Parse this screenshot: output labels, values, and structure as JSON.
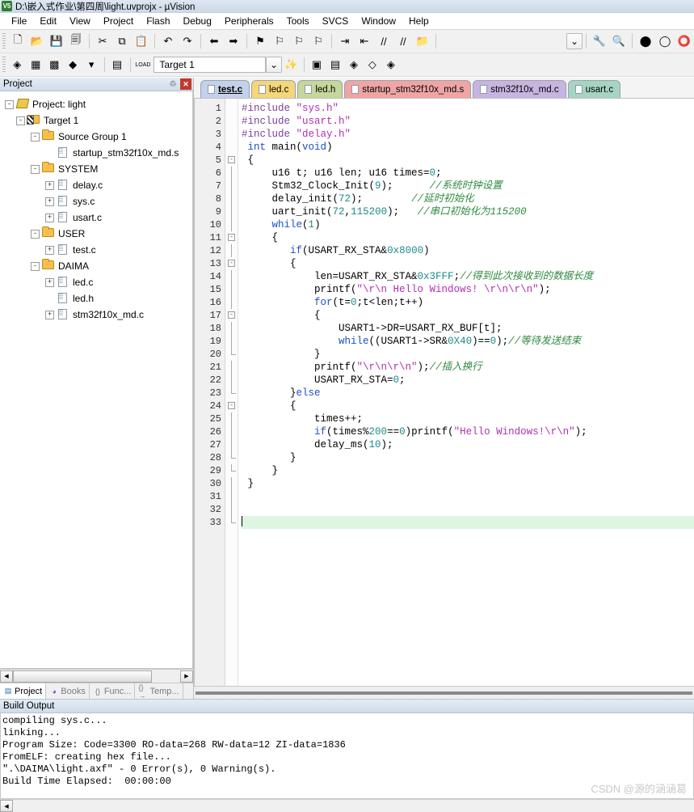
{
  "window": {
    "title": "D:\\嵌入式作业\\第四周\\light.uvprojx - µVision",
    "logo_text": "V5"
  },
  "menubar": {
    "items": [
      {
        "label": "File"
      },
      {
        "label": "Edit"
      },
      {
        "label": "View"
      },
      {
        "label": "Project"
      },
      {
        "label": "Flash"
      },
      {
        "label": "Debug"
      },
      {
        "label": "Peripherals"
      },
      {
        "label": "Tools"
      },
      {
        "label": "SVCS"
      },
      {
        "label": "Window"
      },
      {
        "label": "Help"
      }
    ]
  },
  "toolbar_main": {
    "buttons": [
      {
        "name": "new-file-icon",
        "glyph": "🗋"
      },
      {
        "name": "open-file-icon",
        "glyph": "📂"
      },
      {
        "name": "save-icon",
        "glyph": "💾"
      },
      {
        "name": "save-all-icon",
        "glyph": "🗐"
      },
      {
        "name": "cut-icon",
        "glyph": "✂"
      },
      {
        "name": "copy-icon",
        "glyph": "⧉"
      },
      {
        "name": "paste-icon",
        "glyph": "📋"
      },
      {
        "name": "undo-icon",
        "glyph": "↶"
      },
      {
        "name": "redo-icon",
        "glyph": "↷"
      },
      {
        "name": "navigate-back-icon",
        "glyph": "⬅"
      },
      {
        "name": "navigate-forward-icon",
        "glyph": "➡"
      },
      {
        "name": "toggle-bookmark-icon",
        "glyph": "⚑"
      },
      {
        "name": "prev-bookmark-icon",
        "glyph": "⚐"
      },
      {
        "name": "next-bookmark-icon",
        "glyph": "⚐"
      },
      {
        "name": "clear-bookmarks-icon",
        "glyph": "⚐"
      },
      {
        "name": "indent-icon",
        "glyph": "⇥"
      },
      {
        "name": "outdent-icon",
        "glyph": "⇤"
      },
      {
        "name": "comment-icon",
        "glyph": "//"
      },
      {
        "name": "uncomment-icon",
        "glyph": "//"
      },
      {
        "name": "open-folder-icon",
        "glyph": "📁"
      }
    ],
    "right_buttons": [
      {
        "name": "configure-target-dropdown-icon",
        "glyph": "⌄"
      },
      {
        "name": "options-target-icon",
        "glyph": "🔧"
      },
      {
        "name": "find-in-files-icon",
        "glyph": "🔍"
      },
      {
        "name": "start-debug-icon",
        "glyph": "⬤"
      },
      {
        "name": "insert-breakpoint-icon",
        "glyph": "◯"
      },
      {
        "name": "kill-breakpoints-icon",
        "glyph": "⭕"
      }
    ]
  },
  "toolbar_build": {
    "buttons": [
      {
        "name": "translate-icon",
        "glyph": "◈"
      },
      {
        "name": "build-icon",
        "glyph": "▦"
      },
      {
        "name": "rebuild-icon",
        "glyph": "▩"
      },
      {
        "name": "batch-build-icon",
        "glyph": "◆"
      },
      {
        "name": "batch-build-dropdown-icon",
        "glyph": "▾"
      },
      {
        "name": "stop-build-icon",
        "glyph": "▤"
      },
      {
        "name": "download-icon",
        "glyph": "LOAD"
      }
    ],
    "target_label": "Target 1",
    "right_buttons": [
      {
        "name": "target-options-dropdown-icon",
        "glyph": "⌄"
      },
      {
        "name": "magic-wand-icon",
        "glyph": "✨"
      },
      {
        "name": "manage-project-items-icon",
        "glyph": "▣"
      },
      {
        "name": "multi-project-icon",
        "glyph": "▤"
      },
      {
        "name": "pack-installer-icon",
        "glyph": "◈"
      },
      {
        "name": "manage-run-time-icon",
        "glyph": "◇"
      },
      {
        "name": "select-software-packs-icon",
        "glyph": "◈"
      }
    ]
  },
  "project_panel": {
    "header": "Project",
    "pin_icon": "pin",
    "close_icon": "×",
    "tree": [
      {
        "label": "Project: light",
        "indent": 0,
        "expander": "-",
        "icon": "project",
        "name": "tree-node-project"
      },
      {
        "label": "Target 1",
        "indent": 1,
        "expander": "-",
        "icon": "target",
        "name": "tree-node-target"
      },
      {
        "label": "Source Group 1",
        "indent": 2,
        "expander": "-",
        "icon": "folder",
        "name": "tree-node-source-group-1"
      },
      {
        "label": "startup_stm32f10x_md.s",
        "indent": 3,
        "expander": "",
        "icon": "file",
        "name": "tree-node-startup-file"
      },
      {
        "label": "SYSTEM",
        "indent": 2,
        "expander": "-",
        "icon": "folder",
        "name": "tree-node-system"
      },
      {
        "label": "delay.c",
        "indent": 3,
        "expander": "+",
        "icon": "file",
        "name": "tree-node-delay-c"
      },
      {
        "label": "sys.c",
        "indent": 3,
        "expander": "+",
        "icon": "file",
        "name": "tree-node-sys-c"
      },
      {
        "label": "usart.c",
        "indent": 3,
        "expander": "+",
        "icon": "file",
        "name": "tree-node-usart-c"
      },
      {
        "label": "USER",
        "indent": 2,
        "expander": "-",
        "icon": "folder",
        "name": "tree-node-user"
      },
      {
        "label": "test.c",
        "indent": 3,
        "expander": "+",
        "icon": "file",
        "name": "tree-node-test-c"
      },
      {
        "label": "DAIMA",
        "indent": 2,
        "expander": "-",
        "icon": "folder",
        "name": "tree-node-daima"
      },
      {
        "label": "led.c",
        "indent": 3,
        "expander": "+",
        "icon": "file",
        "name": "tree-node-led-c"
      },
      {
        "label": "led.h",
        "indent": 3,
        "expander": "",
        "icon": "file",
        "name": "tree-node-led-h"
      },
      {
        "label": "stm32f10x_md.c",
        "indent": 3,
        "expander": "+",
        "icon": "file",
        "name": "tree-node-stm32f10x-md-c"
      }
    ],
    "bottom_tabs": [
      {
        "label": "Project",
        "icon": "project-icon",
        "active": true
      },
      {
        "label": "Books",
        "icon": "books-icon",
        "active": false
      },
      {
        "label": "Func...",
        "icon": "{}",
        "active": false
      },
      {
        "label": "Temp...",
        "icon": "{}→",
        "active": false
      }
    ]
  },
  "editor": {
    "tabs": [
      {
        "label": "test.c",
        "color": "#c3d2ea",
        "active": true
      },
      {
        "label": "led.c",
        "color": "#f5d77a",
        "active": false
      },
      {
        "label": "led.h",
        "color": "#c5d79a",
        "active": false
      },
      {
        "label": "startup_stm32f10x_md.s",
        "color": "#f0a5a5",
        "active": false
      },
      {
        "label": "stm32f10x_md.c",
        "color": "#c7b5e0",
        "active": false
      },
      {
        "label": "usart.c",
        "color": "#a6d4c2",
        "active": false
      }
    ],
    "line_count": 33,
    "current_line": 33,
    "lines": [
      {
        "n": 1,
        "fold": "",
        "tokens": [
          {
            "t": "#include ",
            "c": "pre"
          },
          {
            "t": "\"sys.h\"",
            "c": "str"
          }
        ]
      },
      {
        "n": 2,
        "fold": "",
        "tokens": [
          {
            "t": "#include ",
            "c": "pre"
          },
          {
            "t": "\"usart.h\"",
            "c": "str"
          }
        ]
      },
      {
        "n": 3,
        "fold": "",
        "tokens": [
          {
            "t": "#include ",
            "c": "pre"
          },
          {
            "t": "\"delay.h\"",
            "c": "str"
          }
        ]
      },
      {
        "n": 4,
        "fold": "",
        "tokens": [
          {
            "t": " ",
            "c": "txt"
          },
          {
            "t": "int",
            "c": "key"
          },
          {
            "t": " main(",
            "c": "txt"
          },
          {
            "t": "void",
            "c": "key"
          },
          {
            "t": ")",
            "c": "txt"
          }
        ]
      },
      {
        "n": 5,
        "fold": "box-open",
        "tokens": [
          {
            "t": " {",
            "c": "txt"
          }
        ]
      },
      {
        "n": 6,
        "fold": "line",
        "tokens": [
          {
            "t": "     u16 t; u16 len; u16 times=",
            "c": "txt"
          },
          {
            "t": "0",
            "c": "num"
          },
          {
            "t": ";",
            "c": "txt"
          }
        ]
      },
      {
        "n": 7,
        "fold": "line",
        "tokens": [
          {
            "t": "     Stm32_Clock_Init(",
            "c": "txt"
          },
          {
            "t": "9",
            "c": "num"
          },
          {
            "t": ");      ",
            "c": "txt"
          },
          {
            "t": "//系统时钟设置",
            "c": "com"
          }
        ]
      },
      {
        "n": 8,
        "fold": "line",
        "tokens": [
          {
            "t": "     delay_init(",
            "c": "txt"
          },
          {
            "t": "72",
            "c": "num"
          },
          {
            "t": ");        ",
            "c": "txt"
          },
          {
            "t": "//延时初始化",
            "c": "com"
          }
        ]
      },
      {
        "n": 9,
        "fold": "line",
        "tokens": [
          {
            "t": "     uart_init(",
            "c": "txt"
          },
          {
            "t": "72",
            "c": "num"
          },
          {
            "t": ",",
            "c": "txt"
          },
          {
            "t": "115200",
            "c": "num"
          },
          {
            "t": ");   ",
            "c": "txt"
          },
          {
            "t": "//串口初始化为115200",
            "c": "com"
          }
        ]
      },
      {
        "n": 10,
        "fold": "line",
        "tokens": [
          {
            "t": "     ",
            "c": "txt"
          },
          {
            "t": "while",
            "c": "key"
          },
          {
            "t": "(",
            "c": "txt"
          },
          {
            "t": "1",
            "c": "num"
          },
          {
            "t": ")",
            "c": "txt"
          }
        ]
      },
      {
        "n": 11,
        "fold": "box-open",
        "tokens": [
          {
            "t": "     {",
            "c": "txt"
          }
        ]
      },
      {
        "n": 12,
        "fold": "line",
        "tokens": [
          {
            "t": "        ",
            "c": "txt"
          },
          {
            "t": "if",
            "c": "key"
          },
          {
            "t": "(USART_RX_STA&",
            "c": "txt"
          },
          {
            "t": "0x8000",
            "c": "num"
          },
          {
            "t": ")",
            "c": "txt"
          }
        ]
      },
      {
        "n": 13,
        "fold": "box-open",
        "tokens": [
          {
            "t": "        {",
            "c": "txt"
          }
        ]
      },
      {
        "n": 14,
        "fold": "line",
        "tokens": [
          {
            "t": "            len=USART_RX_STA&",
            "c": "txt"
          },
          {
            "t": "0x3FFF",
            "c": "num"
          },
          {
            "t": ";",
            "c": "txt"
          },
          {
            "t": "//得到此次接收到的数据长度",
            "c": "com"
          }
        ]
      },
      {
        "n": 15,
        "fold": "line",
        "tokens": [
          {
            "t": "            printf(",
            "c": "txt"
          },
          {
            "t": "\"\\r\\n Hello Windows! \\r\\n\\r\\n\"",
            "c": "str"
          },
          {
            "t": ");",
            "c": "txt"
          }
        ]
      },
      {
        "n": 16,
        "fold": "line",
        "tokens": [
          {
            "t": "            ",
            "c": "txt"
          },
          {
            "t": "for",
            "c": "key"
          },
          {
            "t": "(t=",
            "c": "txt"
          },
          {
            "t": "0",
            "c": "num"
          },
          {
            "t": ";t<len;t++)",
            "c": "txt"
          }
        ]
      },
      {
        "n": 17,
        "fold": "box-open",
        "tokens": [
          {
            "t": "            {",
            "c": "txt"
          }
        ]
      },
      {
        "n": 18,
        "fold": "line",
        "tokens": [
          {
            "t": "                USART1->DR=USART_RX_BUF[t];",
            "c": "txt"
          }
        ]
      },
      {
        "n": 19,
        "fold": "line",
        "tokens": [
          {
            "t": "                ",
            "c": "txt"
          },
          {
            "t": "while",
            "c": "key"
          },
          {
            "t": "((USART1->SR&",
            "c": "txt"
          },
          {
            "t": "0X40",
            "c": "num"
          },
          {
            "t": ")==",
            "c": "txt"
          },
          {
            "t": "0",
            "c": "num"
          },
          {
            "t": ");",
            "c": "txt"
          },
          {
            "t": "//等待发送结束",
            "c": "com"
          }
        ]
      },
      {
        "n": 20,
        "fold": "end",
        "tokens": [
          {
            "t": "            }",
            "c": "txt"
          }
        ]
      },
      {
        "n": 21,
        "fold": "line",
        "tokens": [
          {
            "t": "            printf(",
            "c": "txt"
          },
          {
            "t": "\"\\r\\n\\r\\n\"",
            "c": "str"
          },
          {
            "t": ");",
            "c": "txt"
          },
          {
            "t": "//插入换行",
            "c": "com"
          }
        ]
      },
      {
        "n": 22,
        "fold": "line",
        "tokens": [
          {
            "t": "            USART_RX_STA=",
            "c": "txt"
          },
          {
            "t": "0",
            "c": "num"
          },
          {
            "t": ";",
            "c": "txt"
          }
        ]
      },
      {
        "n": 23,
        "fold": "end",
        "tokens": [
          {
            "t": "        }",
            "c": "txt"
          },
          {
            "t": "else",
            "c": "key"
          }
        ]
      },
      {
        "n": 24,
        "fold": "box-open",
        "tokens": [
          {
            "t": "        {",
            "c": "txt"
          }
        ]
      },
      {
        "n": 25,
        "fold": "line",
        "tokens": [
          {
            "t": "            times++;",
            "c": "txt"
          }
        ]
      },
      {
        "n": 26,
        "fold": "line",
        "tokens": [
          {
            "t": "            ",
            "c": "txt"
          },
          {
            "t": "if",
            "c": "key"
          },
          {
            "t": "(times%",
            "c": "txt"
          },
          {
            "t": "200",
            "c": "num"
          },
          {
            "t": "==",
            "c": "txt"
          },
          {
            "t": "0",
            "c": "num"
          },
          {
            "t": ")printf(",
            "c": "txt"
          },
          {
            "t": "\"Hello Windows!\\r\\n\"",
            "c": "str"
          },
          {
            "t": ");",
            "c": "txt"
          }
        ]
      },
      {
        "n": 27,
        "fold": "line",
        "tokens": [
          {
            "t": "            delay_ms(",
            "c": "txt"
          },
          {
            "t": "10",
            "c": "num"
          },
          {
            "t": ");",
            "c": "txt"
          }
        ]
      },
      {
        "n": 28,
        "fold": "end",
        "tokens": [
          {
            "t": "        }",
            "c": "txt"
          }
        ]
      },
      {
        "n": 29,
        "fold": "end",
        "tokens": [
          {
            "t": "     }",
            "c": "txt"
          }
        ]
      },
      {
        "n": 30,
        "fold": "line",
        "tokens": [
          {
            "t": " }",
            "c": "txt"
          }
        ]
      },
      {
        "n": 31,
        "fold": "line",
        "tokens": [
          {
            "t": "",
            "c": "txt"
          }
        ]
      },
      {
        "n": 32,
        "fold": "line",
        "tokens": [
          {
            "t": "",
            "c": "txt"
          }
        ]
      },
      {
        "n": 33,
        "fold": "end",
        "tokens": [
          {
            "t": "",
            "c": "txt"
          }
        ]
      }
    ]
  },
  "build_output": {
    "header": "Build Output",
    "lines": [
      "compiling sys.c...",
      "linking...",
      "Program Size: Code=3300 RO-data=268 RW-data=12 ZI-data=1836",
      "FromELF: creating hex file...",
      "\".\\DAIMA\\light.axf\" - 0 Error(s), 0 Warning(s).",
      "Build Time Elapsed:  00:00:00"
    ]
  },
  "watermark": {
    "text": "CSDN @源的涵涵葛"
  }
}
